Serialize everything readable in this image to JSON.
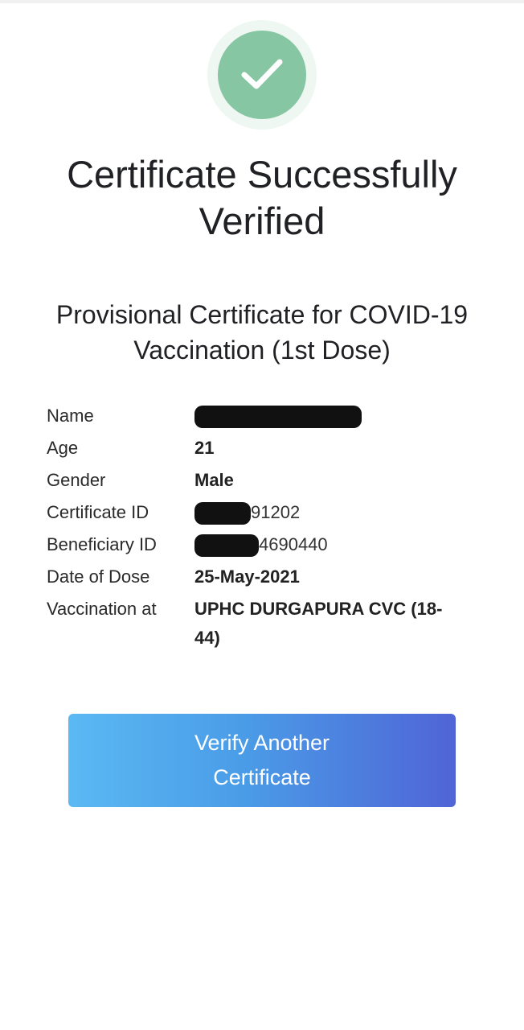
{
  "header": {
    "title": "Certificate Successfully Verified",
    "subtitle": "Provisional Certificate for COVID-19 Vaccination (1st Dose)"
  },
  "details": [
    {
      "label": "Name",
      "value": "",
      "redacted": true
    },
    {
      "label": "Age",
      "value": "21",
      "redacted": false
    },
    {
      "label": "Gender",
      "value": "Male",
      "redacted": false
    },
    {
      "label": "Certificate ID",
      "value": "91202",
      "redacted": true
    },
    {
      "label": "Beneficiary ID",
      "value": "4690440",
      "redacted": true
    },
    {
      "label": "Date of Dose",
      "value": "25-May-2021",
      "redacted": false
    },
    {
      "label": "Vaccination at",
      "value": "UPHC DURGAPURA CVC (18-44)",
      "redacted": false
    }
  ],
  "button": {
    "label": "Verify Another Certificate"
  },
  "colors": {
    "success_green": "#86c6a2",
    "button_gradient_start": "#5bb9f3",
    "button_gradient_end": "#5064d6"
  },
  "icons": {
    "status": "check-icon"
  }
}
